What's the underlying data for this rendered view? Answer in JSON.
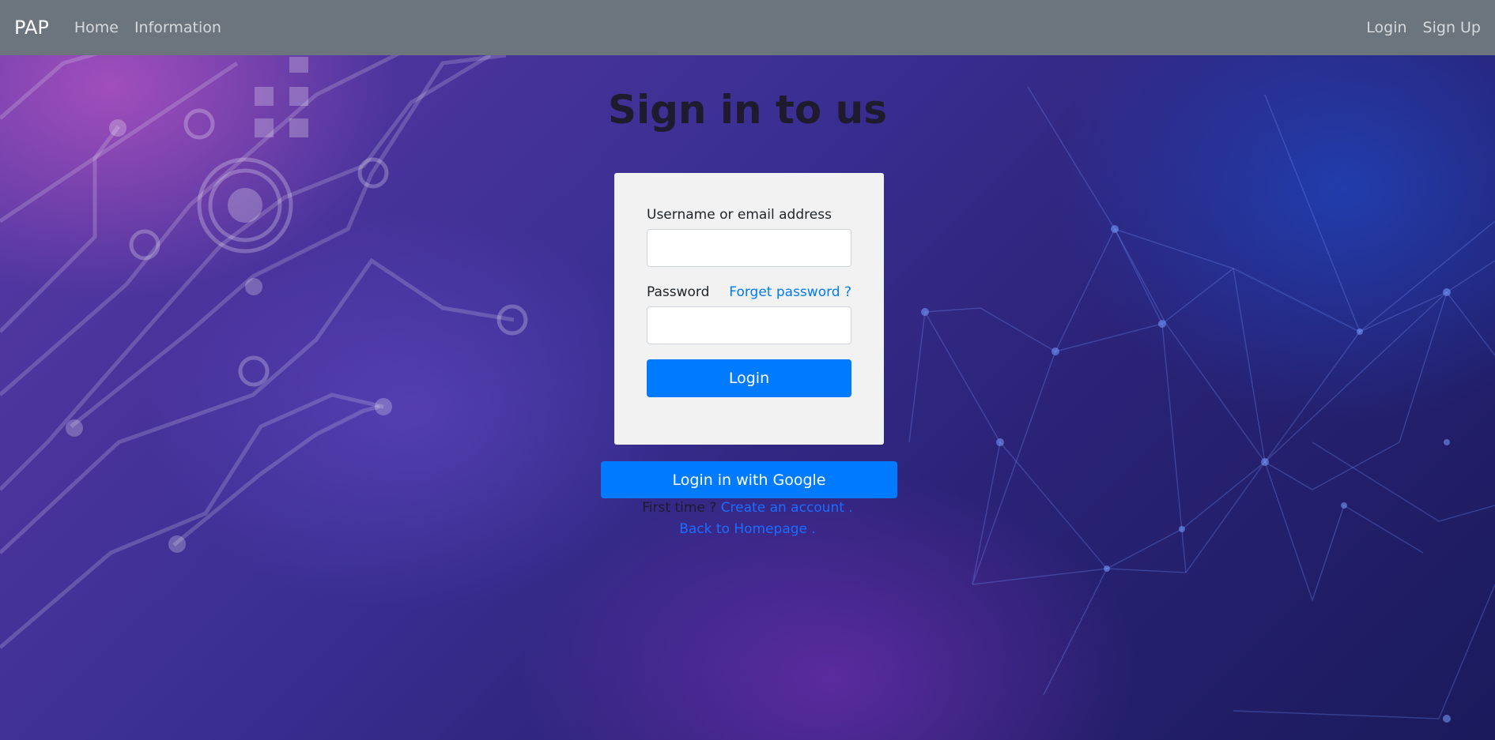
{
  "navbar": {
    "brand": "PAP",
    "links_left": [
      "Home",
      "Information"
    ],
    "links_right": [
      "Login",
      "Sign Up"
    ],
    "background": "#6c757d"
  },
  "page": {
    "title": "Sign in to us"
  },
  "login_form": {
    "username_label": "Username or email address",
    "username_value": "",
    "password_label": "Password",
    "password_value": "",
    "forgot_password": "Forget password ?",
    "login_button": "Login"
  },
  "google_button": "Login in with Google",
  "footer": {
    "first_time_text": "First time ?",
    "create_account_link": "Create an account",
    "create_account_suffix": ".",
    "back_home_link": "Back to Homepage",
    "back_home_suffix": "."
  },
  "colors": {
    "primary": "#007bff",
    "card_background": "#f2f2f2"
  }
}
